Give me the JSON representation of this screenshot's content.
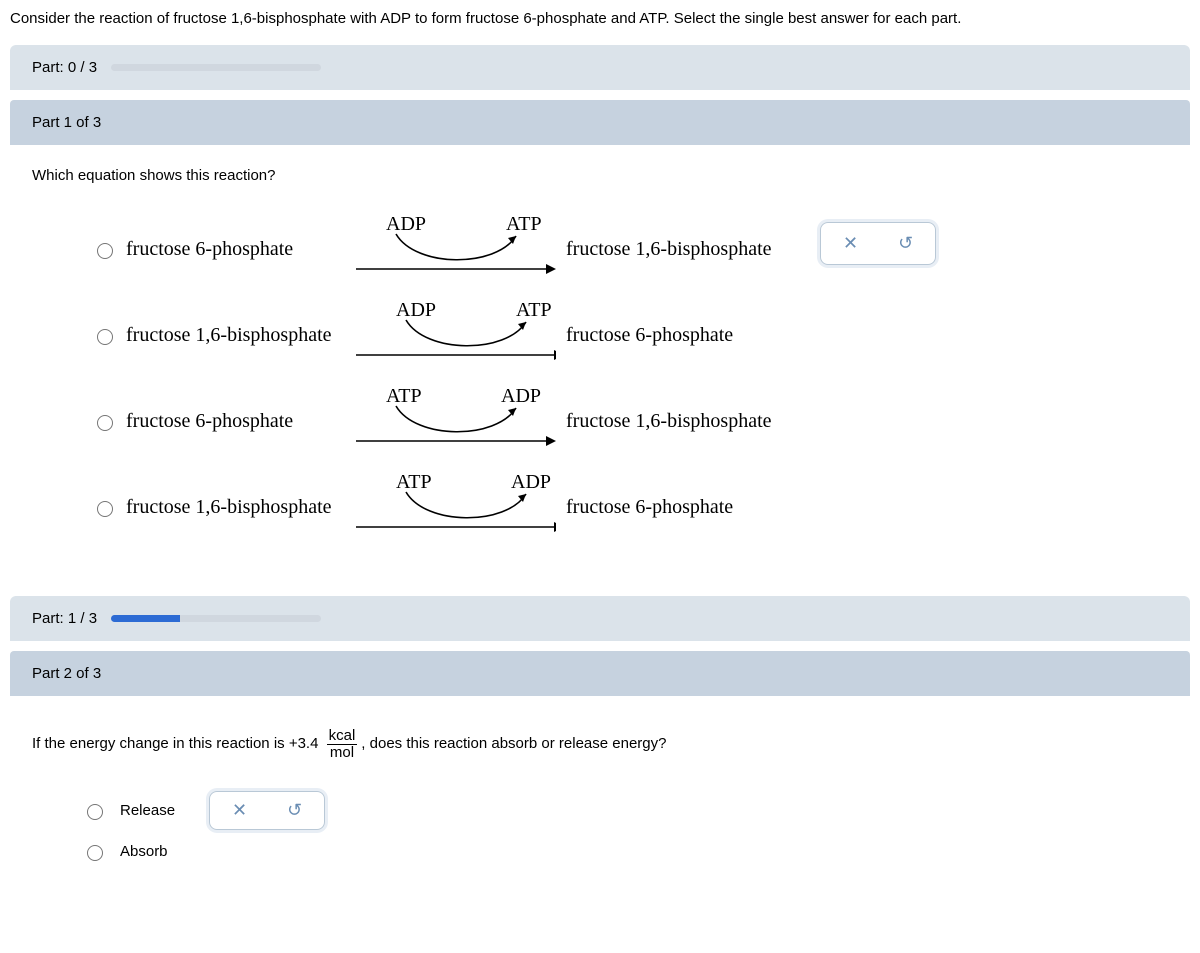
{
  "intro": "Consider the reaction of fructose 1,6-bisphosphate with ADP to form fructose 6-phosphate and ATP. Select the single best answer for each part.",
  "part_progress_0_label": "Part: 0 / 3",
  "part1_header": "Part 1 of 3",
  "part1_question": "Which equation shows this reaction?",
  "options": [
    {
      "left": "fructose 6-phosphate",
      "labL": "ADP",
      "labR": "ATP",
      "right": "fructose 1,6-bisphosphate"
    },
    {
      "left": "fructose 1,6-bisphosphate",
      "labL": "ADP",
      "labR": "ATP",
      "right": "fructose 6-phosphate"
    },
    {
      "left": "fructose 6-phosphate",
      "labL": "ATP",
      "labR": "ADP",
      "right": "fructose 1,6-bisphosphate"
    },
    {
      "left": "fructose 1,6-bisphosphate",
      "labL": "ATP",
      "labR": "ADP",
      "right": "fructose 6-phosphate"
    }
  ],
  "ctrl_x": "✕",
  "ctrl_undo": "↺",
  "part_progress_1_label": "Part: 1 / 3",
  "part2_header": "Part 2 of 3",
  "part2_q_a": "If the energy change in this reaction is +3.4",
  "part2_q_num": "kcal",
  "part2_q_den": "mol",
  "part2_q_b": ", does this reaction absorb or release energy?",
  "choice_release": "Release",
  "choice_absorb": "Absorb"
}
